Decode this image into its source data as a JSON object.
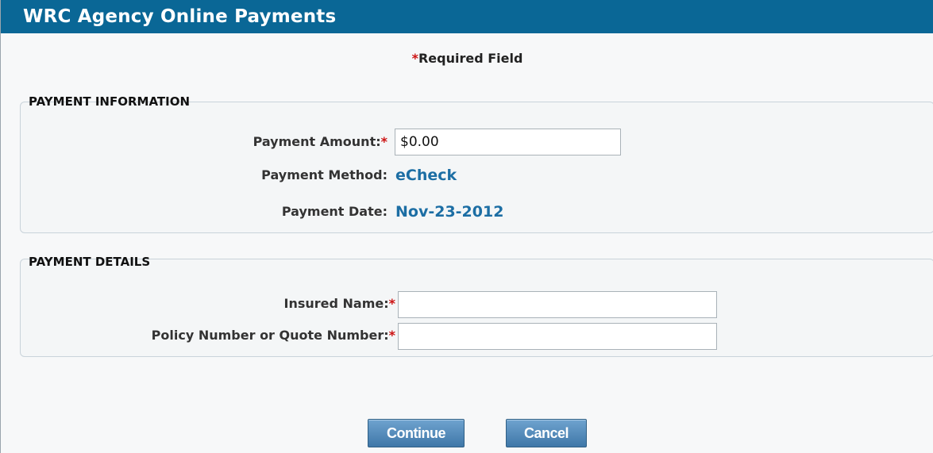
{
  "header": {
    "title": "WRC Agency Online Payments"
  },
  "required_note": {
    "star": "*",
    "text": "Required Field"
  },
  "payment_information": {
    "legend": "PAYMENT INFORMATION",
    "amount_label": "Payment Amount:",
    "amount_value": "$0.00",
    "method_label": "Payment Method:",
    "method_value": "eCheck",
    "date_label": "Payment Date:",
    "date_value": "Nov-23-2012"
  },
  "payment_details": {
    "legend": "PAYMENT DETAILS",
    "insured_label": "Insured Name:",
    "insured_value": "",
    "policy_label": "Policy Number or Quote Number:",
    "policy_value": ""
  },
  "required_star": "*",
  "buttons": {
    "continue": "Continue",
    "cancel": "Cancel"
  },
  "colors": {
    "header_bg": "#0a6796",
    "link_value": "#1c6ea4",
    "required_star": "#cc1111"
  }
}
